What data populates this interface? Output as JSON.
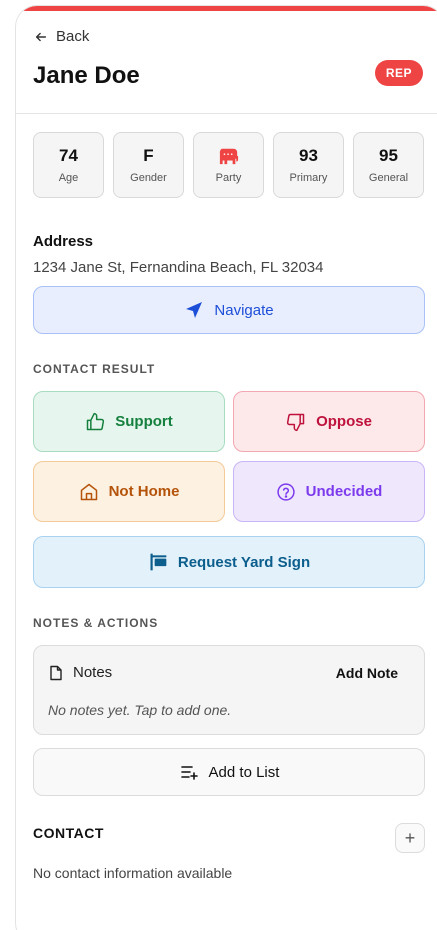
{
  "header": {
    "back_label": "Back",
    "name": "Jane Doe",
    "party_badge": "REP",
    "accent_color": "#ef4444"
  },
  "stats": [
    {
      "value": "74",
      "label": "Age"
    },
    {
      "value": "F",
      "label": "Gender"
    },
    {
      "icon": "elephant-icon",
      "label": "Party"
    },
    {
      "value": "93",
      "label": "Primary"
    },
    {
      "value": "95",
      "label": "General"
    }
  ],
  "address": {
    "label": "Address",
    "value": "1234 Jane St, Fernandina Beach, FL 32034",
    "navigate_label": "Navigate"
  },
  "contact_result": {
    "section_title": "CONTACT RESULT",
    "support_label": "Support",
    "oppose_label": "Oppose",
    "not_home_label": "Not Home",
    "undecided_label": "Undecided",
    "yard_sign_label": "Request Yard Sign"
  },
  "notes_actions": {
    "section_title": "NOTES & ACTIONS",
    "notes_title": "Notes",
    "add_note_label": "Add Note",
    "empty_text": "No notes yet. Tap to add one.",
    "add_to_list_label": "Add to List"
  },
  "contact": {
    "title": "CONTACT",
    "add_symbol": "+",
    "empty_text": "No contact information available"
  }
}
